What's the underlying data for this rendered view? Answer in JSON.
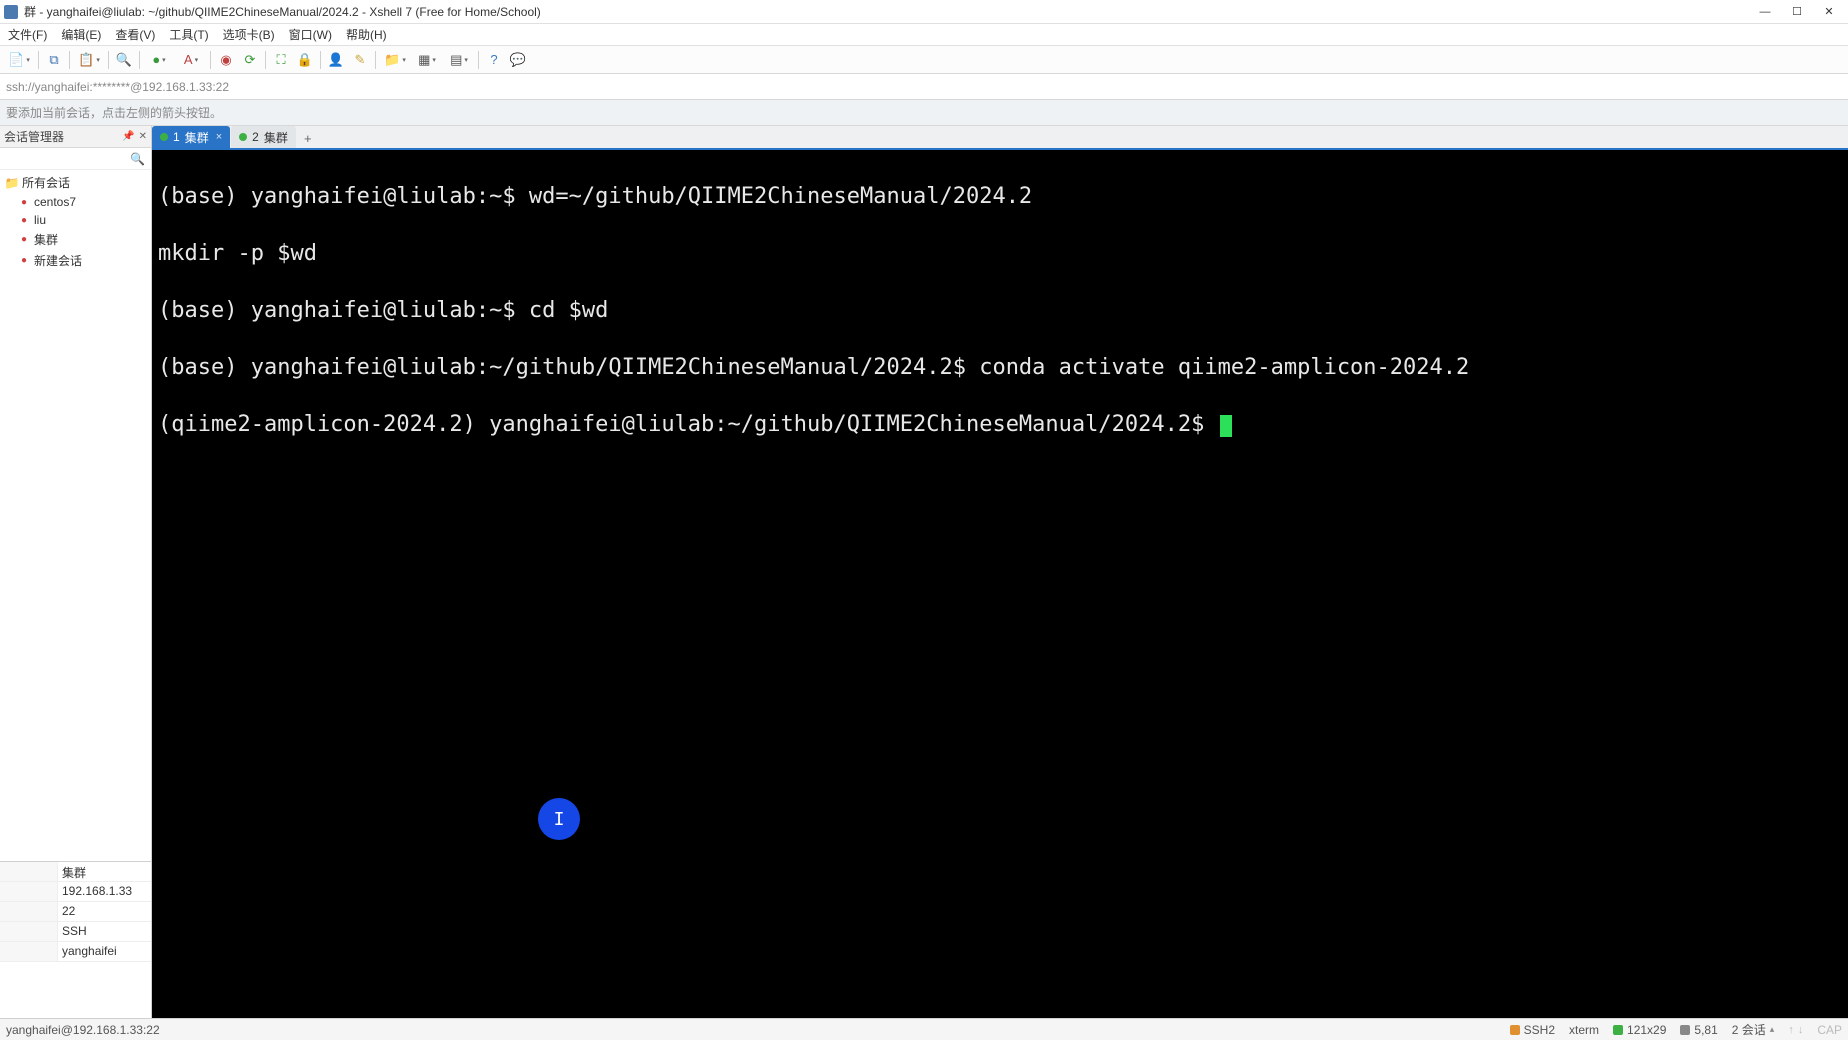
{
  "titlebar": {
    "text": "群 - yanghaifei@liulab: ~/github/QIIME2ChineseManual/2024.2 - Xshell 7 (Free for Home/School)"
  },
  "menu": {
    "file": "文件(F)",
    "edit": "编辑(E)",
    "view": "查看(V)",
    "tools": "工具(T)",
    "tabs": "选项卡(B)",
    "window": "窗口(W)",
    "help": "帮助(H)"
  },
  "addressbar": {
    "text": "ssh://yanghaifei:********@192.168.1.33:22"
  },
  "hintbar": {
    "text": "要添加当前会话，点击左侧的箭头按钮。"
  },
  "sidebar": {
    "header": "会话管理器",
    "search_placeholder": "🔍",
    "tree": [
      {
        "label": "所有会话",
        "type": "folder",
        "indent": false
      },
      {
        "label": "centos7",
        "type": "session",
        "indent": true
      },
      {
        "label": "liu",
        "type": "session",
        "indent": true
      },
      {
        "label": "集群",
        "type": "session",
        "indent": true
      },
      {
        "label": "新建会话",
        "type": "session",
        "indent": true
      }
    ],
    "props": {
      "r0": {
        "k": "",
        "v": "集群"
      },
      "r1": {
        "k": "",
        "v": "192.168.1.33"
      },
      "r2": {
        "k": "",
        "v": "22"
      },
      "r3": {
        "k": "",
        "v": "SSH"
      },
      "r4": {
        "k": "",
        "v": "yanghaifei"
      }
    }
  },
  "tabs": {
    "t1": {
      "num": "1",
      "label": "集群"
    },
    "t2": {
      "num": "2",
      "label": "集群"
    }
  },
  "terminal": {
    "l1": "(base) yanghaifei@liulab:~$ wd=~/github/QIIME2ChineseManual/2024.2",
    "l2": "mkdir -p $wd",
    "l3": "(base) yanghaifei@liulab:~$ cd $wd",
    "l4": "(base) yanghaifei@liulab:~/github/QIIME2ChineseManual/2024.2$ conda activate qiime2-amplicon-2024.2",
    "l5": "(qiime2-amplicon-2024.2) yanghaifei@liulab:~/github/QIIME2ChineseManual/2024.2$ "
  },
  "mouse_marker": "I",
  "statusbar": {
    "left": "yanghaifei@192.168.1.33:22",
    "ssh": "SSH2",
    "term": "xterm",
    "size": "121x29",
    "pos": "5,81",
    "sess": "2 会话",
    "cap": "CAP"
  }
}
